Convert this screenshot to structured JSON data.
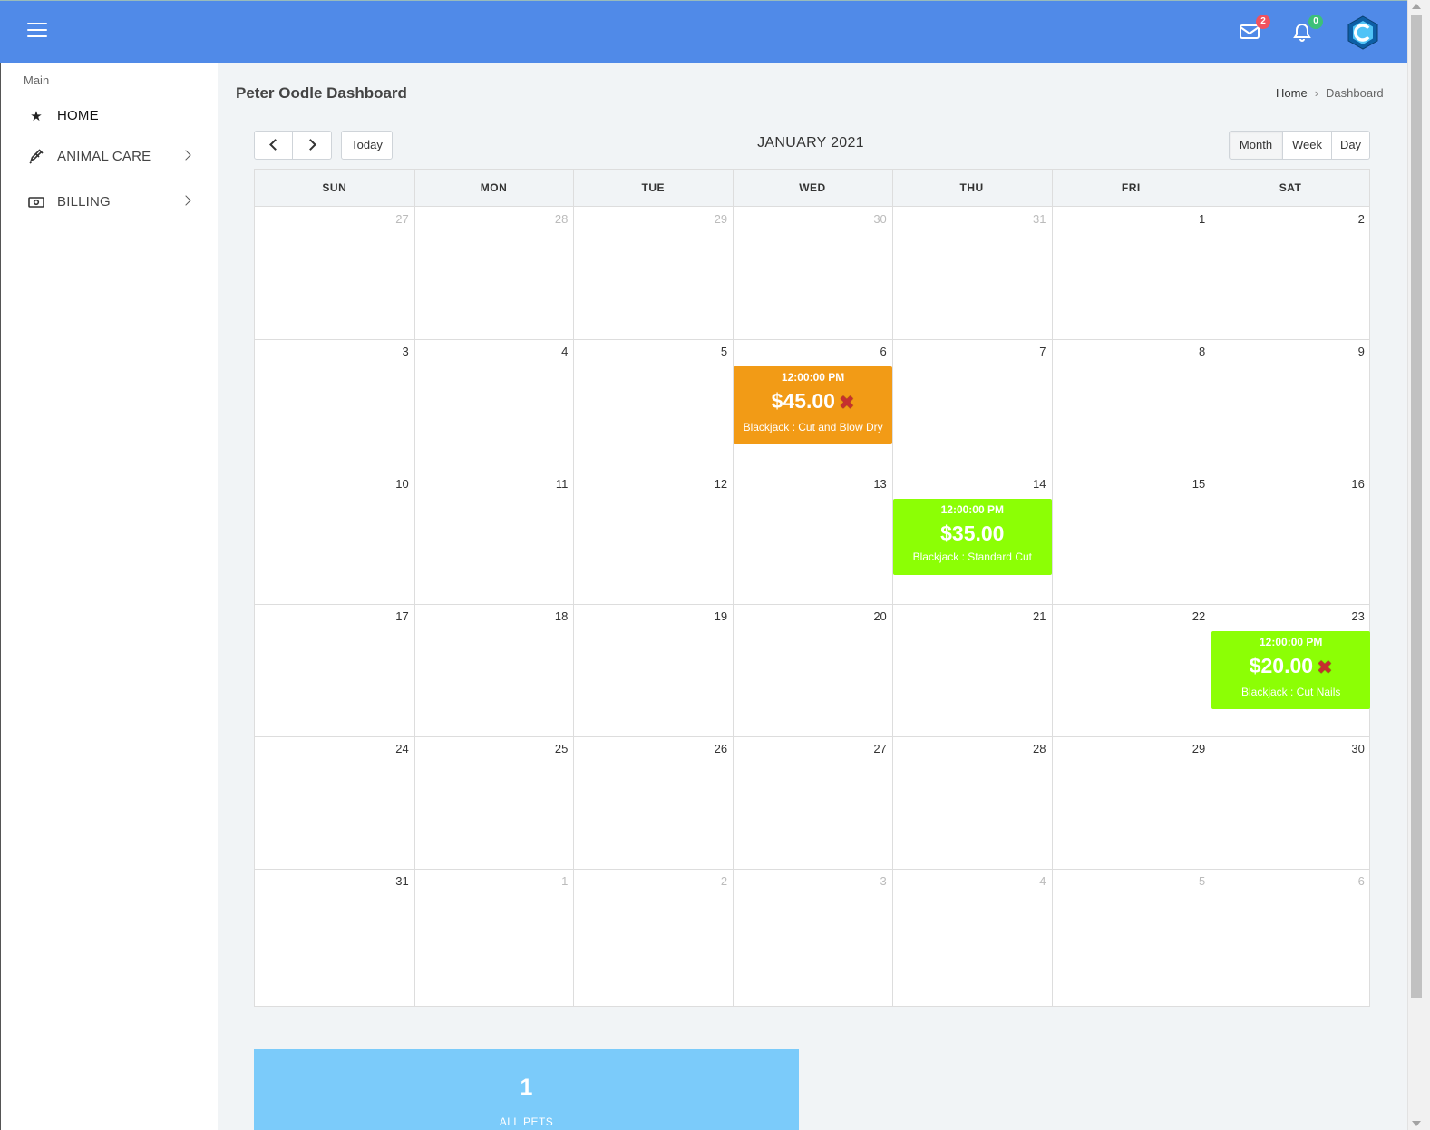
{
  "header": {
    "mail_badge": "2",
    "notification_badge": "0"
  },
  "sidebar": {
    "section": "Main",
    "items": [
      {
        "label": "HOME",
        "icon": "star-icon"
      },
      {
        "label": "ANIMAL CARE",
        "icon": "syringe-icon"
      },
      {
        "label": "BILLING",
        "icon": "money-icon"
      }
    ]
  },
  "page": {
    "title": "Peter Oodle Dashboard",
    "breadcrumb": [
      "Home",
      "Dashboard"
    ]
  },
  "calendar": {
    "title": "JANUARY 2021",
    "today_label": "Today",
    "views": [
      "Month",
      "Week",
      "Day"
    ],
    "weekdays": [
      "SUN",
      "MON",
      "TUE",
      "WED",
      "THU",
      "FRI",
      "SAT"
    ],
    "weeks": [
      [
        {
          "d": "27",
          "other": true
        },
        {
          "d": "28",
          "other": true
        },
        {
          "d": "29",
          "other": true
        },
        {
          "d": "30",
          "other": true
        },
        {
          "d": "31",
          "other": true
        },
        {
          "d": "1"
        },
        {
          "d": "2"
        }
      ],
      [
        {
          "d": "3"
        },
        {
          "d": "4"
        },
        {
          "d": "5"
        },
        {
          "d": "6"
        },
        {
          "d": "7"
        },
        {
          "d": "8"
        },
        {
          "d": "9"
        }
      ],
      [
        {
          "d": "10"
        },
        {
          "d": "11"
        },
        {
          "d": "12"
        },
        {
          "d": "13"
        },
        {
          "d": "14"
        },
        {
          "d": "15"
        },
        {
          "d": "16"
        }
      ],
      [
        {
          "d": "17"
        },
        {
          "d": "18"
        },
        {
          "d": "19"
        },
        {
          "d": "20"
        },
        {
          "d": "21"
        },
        {
          "d": "22"
        },
        {
          "d": "23"
        }
      ],
      [
        {
          "d": "24"
        },
        {
          "d": "25"
        },
        {
          "d": "26"
        },
        {
          "d": "27"
        },
        {
          "d": "28"
        },
        {
          "d": "29"
        },
        {
          "d": "30"
        }
      ],
      [
        {
          "d": "31"
        },
        {
          "d": "1",
          "other": true
        },
        {
          "d": "2",
          "other": true
        },
        {
          "d": "3",
          "other": true
        },
        {
          "d": "4",
          "other": true
        },
        {
          "d": "5",
          "other": true
        },
        {
          "d": "6",
          "other": true
        }
      ]
    ],
    "events": [
      {
        "time": "12:00:00 PM",
        "amount": "$45.00",
        "cancelled": true,
        "description": "Blackjack : Cut and Blow Dry",
        "color": "#f29b16",
        "date": "2021-01-06"
      },
      {
        "time": "12:00:00 PM",
        "amount": "$35.00",
        "cancelled": false,
        "description": "Blackjack : Standard Cut",
        "color": "#8cff05",
        "date": "2021-01-14"
      },
      {
        "time": "12:00:00 PM",
        "amount": "$20.00",
        "cancelled": true,
        "description": "Blackjack : Cut Nails",
        "color": "#8cff05",
        "date": "2021-01-23"
      }
    ]
  },
  "stats": {
    "value": "1",
    "label": "ALL PETS"
  },
  "colors": {
    "topbar": "#508ae8",
    "stat_card": "#7bcbfa"
  }
}
